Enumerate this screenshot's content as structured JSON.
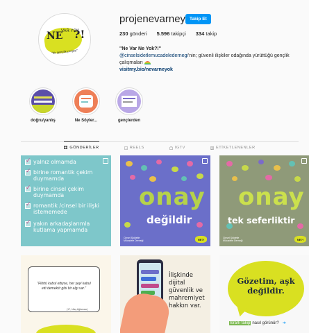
{
  "profile": {
    "username": "projenevarneyok",
    "follow_label": "Takip Et",
    "stats": [
      {
        "value": "230",
        "label": " gönderi"
      },
      {
        "value": "5.596",
        "label": " takipçi"
      },
      {
        "value": "334",
        "label": " takip"
      }
    ],
    "bio_name": "\"Ne Var Ne Yok?!\"",
    "bio_mention": "@cinselsidetlemucadeledernegi",
    "bio_text": "'nin; güvenli ilişkiler odağında yürüttüğü gençlik çalışmaları",
    "bio_link": "visitmy.bio/nevarneyok",
    "avatar": {
      "ne": "NE",
      "var": "VAR YOK",
      "q": "?!",
      "sub": "\"bir gençlik projesi\""
    }
  },
  "highlights": [
    {
      "label": "doğru/yanlış"
    },
    {
      "label": "Ne Söyler..."
    },
    {
      "label": "gençlerden"
    }
  ],
  "tabs": [
    {
      "label": "GÖNDERİLER",
      "active": true
    },
    {
      "label": "REELS",
      "active": false
    },
    {
      "label": "IGTV",
      "active": false
    },
    {
      "label": "ETİKETLENENLER",
      "active": false
    }
  ],
  "posts": {
    "p1": {
      "lines": [
        "yalnız olmamda",
        "birine romantik çekim duymamda",
        "birine cinsel çekim duymamda",
        "romantik /cinsel bir ilişki istememede",
        "yakın arkadaşlarımla kutlama yapmamda"
      ]
    },
    "p2": {
      "big": "onay",
      "sub": "değildir",
      "logo": "Cinsel Şiddetle Mücadele Derneği",
      "ne": "NE?!"
    },
    "p3": {
      "big": "onay",
      "sub": "tek seferliktir",
      "logo": "Cinsel Şiddetle Mücadele Derneği",
      "ne": "NE?!"
    },
    "p4": {
      "quote": "\"Flörtü kabul ettiyse, her şeyi kabul etti demektir gibi bir algı var.\"",
      "author": "(17, Ulaş Ağlamacı)"
    },
    "p5": {
      "text": "İlişkinde dijital güvenlik ve mahremiyet hakkın var."
    },
    "p6": {
      "bubble": "Gözetim, aşk değildir.",
      "line_hl": "İsrarlı takip",
      "line_rest": "nasıl görünür?",
      "arrow": "➜"
    }
  },
  "colors": {
    "accent_blue": "#0095f6",
    "lime": "#d9e021",
    "teal_post": "#7ec7ca",
    "purple_post": "#6b6fc9",
    "olive_post": "#8f9a79"
  }
}
